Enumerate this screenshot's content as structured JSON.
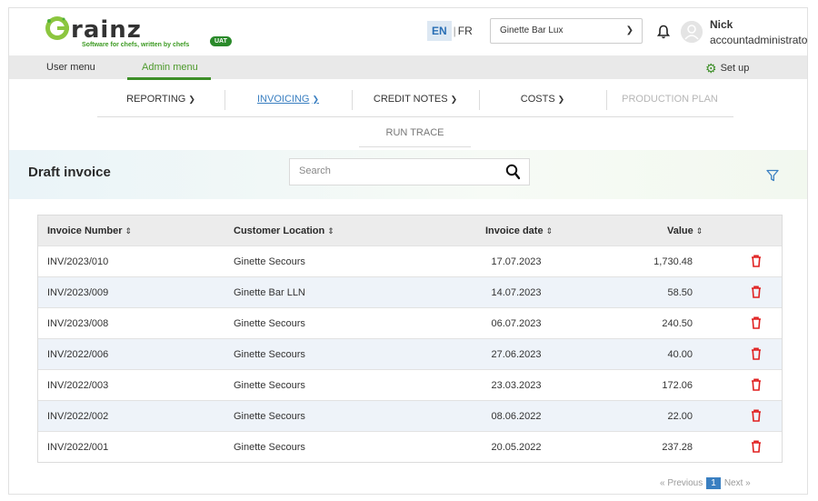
{
  "brand": {
    "name": "rainz",
    "tagline": "Software for chefs, written by chefs",
    "env_badge": "UAT",
    "accent": "#3d8f28"
  },
  "header": {
    "languages": [
      {
        "code": "EN",
        "active": true
      },
      {
        "code": "FR",
        "active": false
      }
    ],
    "venue_selected": "Ginette Bar Lux",
    "user_name": "Nick",
    "user_role": "accountadministrator"
  },
  "menu": {
    "tabs": [
      {
        "label": "User menu",
        "active": false
      },
      {
        "label": "Admin menu",
        "active": true
      }
    ],
    "setup_label": "Set up"
  },
  "nav": {
    "items": [
      {
        "label": "REPORTING",
        "state": "normal"
      },
      {
        "label": "INVOICING",
        "state": "active"
      },
      {
        "label": "CREDIT NOTES",
        "state": "normal"
      },
      {
        "label": "COSTS",
        "state": "normal"
      },
      {
        "label": "PRODUCTION PLAN",
        "state": "disabled"
      }
    ],
    "sub_item": "RUN TRACE",
    "active_color": "#3a7fc1"
  },
  "page": {
    "title": "Draft invoice",
    "search_placeholder": "Search"
  },
  "table": {
    "columns": [
      "Invoice Number",
      "Customer Location",
      "Invoice date",
      "Value"
    ],
    "rows": [
      {
        "number": "INV/2023/010",
        "location": "Ginette Secours",
        "date": "17.07.2023",
        "value": "1,730.48"
      },
      {
        "number": "INV/2023/009",
        "location": "Ginette Bar LLN",
        "date": "14.07.2023",
        "value": "58.50"
      },
      {
        "number": "INV/2023/008",
        "location": "Ginette Secours",
        "date": "06.07.2023",
        "value": "240.50"
      },
      {
        "number": "INV/2022/006",
        "location": "Ginette Secours",
        "date": "27.06.2023",
        "value": "40.00"
      },
      {
        "number": "INV/2022/003",
        "location": "Ginette Secours",
        "date": "23.03.2023",
        "value": "172.06"
      },
      {
        "number": "INV/2022/002",
        "location": "Ginette Secours",
        "date": "08.06.2022",
        "value": "22.00"
      },
      {
        "number": "INV/2022/001",
        "location": "Ginette Secours",
        "date": "20.05.2022",
        "value": "237.28"
      }
    ],
    "delete_color": "#e02020"
  },
  "pagination": {
    "previous_label": "« Previous",
    "current_page": "1",
    "next_label": "Next »"
  }
}
